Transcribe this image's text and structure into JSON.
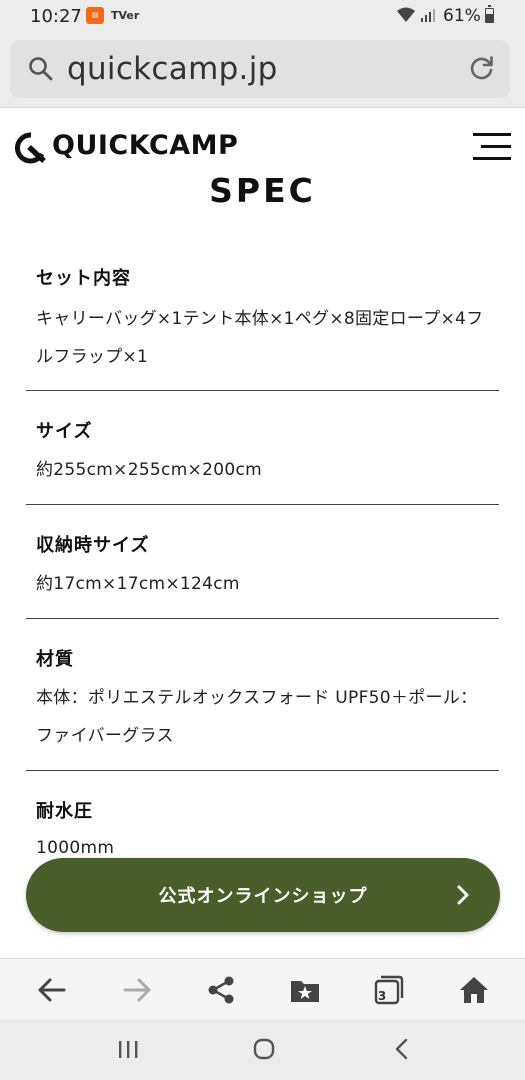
{
  "status_bar": {
    "time": "10:27",
    "notification_icons": [
      "app-notification-icon",
      "tver-icon"
    ],
    "tver_label": "TVer",
    "battery": "61%",
    "battery_level": 0.61
  },
  "browser": {
    "url": "quickcamp.jp"
  },
  "site": {
    "logo_text": "QUICKCAMP",
    "section_title": "SPEC"
  },
  "specs": [
    {
      "label": "セット内容",
      "value": "キャリーバッグ×1テント本体×1ペグ×8固定ロープ×4フルフラップ×1"
    },
    {
      "label": "サイズ",
      "value": "約255cm×255cm×200cm"
    },
    {
      "label": "収納時サイズ",
      "value": "約17cm×17cm×124cm"
    },
    {
      "label": "材質",
      "value": "本体：ポリエステルオックスフォード UPF50＋ポール：ファイバーグラス"
    },
    {
      "label": "耐水圧",
      "value": "1000mm"
    }
  ],
  "cta": {
    "label": "公式オンラインショップ"
  },
  "toolbar": {
    "tabs_count": "3"
  },
  "colors": {
    "accent_green": "#4a5e29"
  }
}
